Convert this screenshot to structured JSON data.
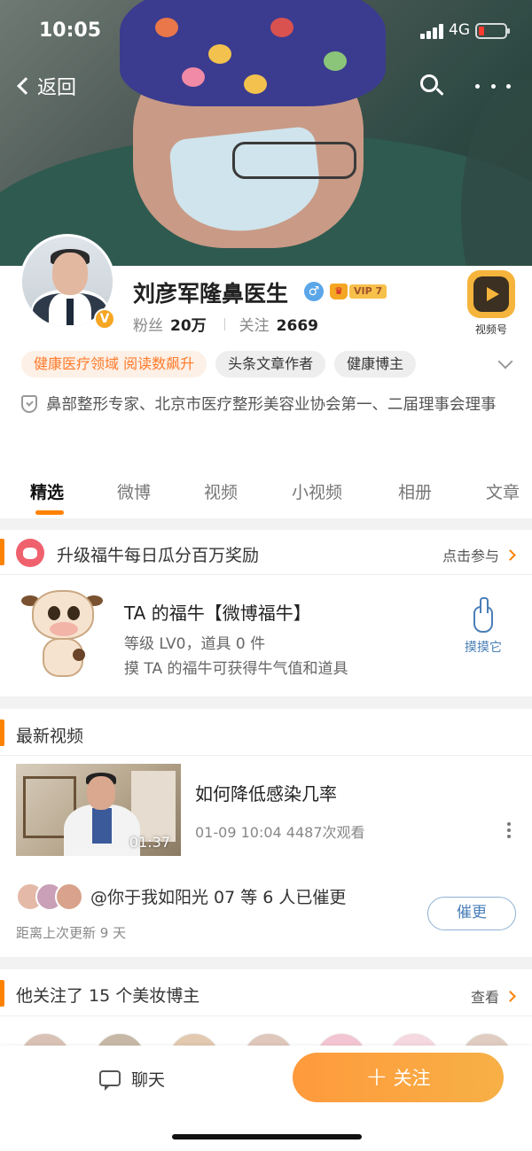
{
  "status": {
    "time": "10:05",
    "network": "4G"
  },
  "nav": {
    "back_label": "返回"
  },
  "profile": {
    "name": "刘彦军隆鼻医生",
    "gender_symbol": "♂",
    "vip_label": "VIP 7",
    "verified_mark": "V",
    "followers_label": "粉丝",
    "followers_value": "20万",
    "following_label": "关注",
    "following_value": "2669",
    "channel_label": "视频号",
    "tags": [
      "健康医疗领域 阅读数飙升",
      "头条文章作者",
      "健康博主"
    ],
    "bio": "鼻部整形专家、北京市医疗整形美容业协会第一、二届理事会理事"
  },
  "tabs": [
    "精选",
    "微博",
    "视频",
    "小视频",
    "相册",
    "文章"
  ],
  "fortune_card": {
    "title": "升级福牛每日瓜分百万奖励",
    "link": "点击参与",
    "cow_title": "TA 的福牛【微博福牛】",
    "cow_level": "等级 LV0，道具 0 件",
    "cow_hint": "摸 TA 的福牛可获得牛气值和道具",
    "touch_label": "摸摸它"
  },
  "latest_video": {
    "section_title": "最新视频",
    "video_title": "如何降低感染几率",
    "video_meta": "01-09 10:04 4487次观看",
    "duration": "01:37",
    "urge_text": "@你于我如阳光 07 等 6 人已催更",
    "urge_sub": "距离上次更新 9 天",
    "urge_button": "催更"
  },
  "following_section": {
    "title": "他关注了 15 个美妆博主",
    "link": "查看"
  },
  "bottom": {
    "chat_label": "聊天",
    "follow_label": "关注"
  },
  "colors": {
    "accent": "#ff8200",
    "link_blue": "#4a7fb8",
    "follow_gradient_start": "#ff9a3c",
    "follow_gradient_end": "#f7b046"
  }
}
